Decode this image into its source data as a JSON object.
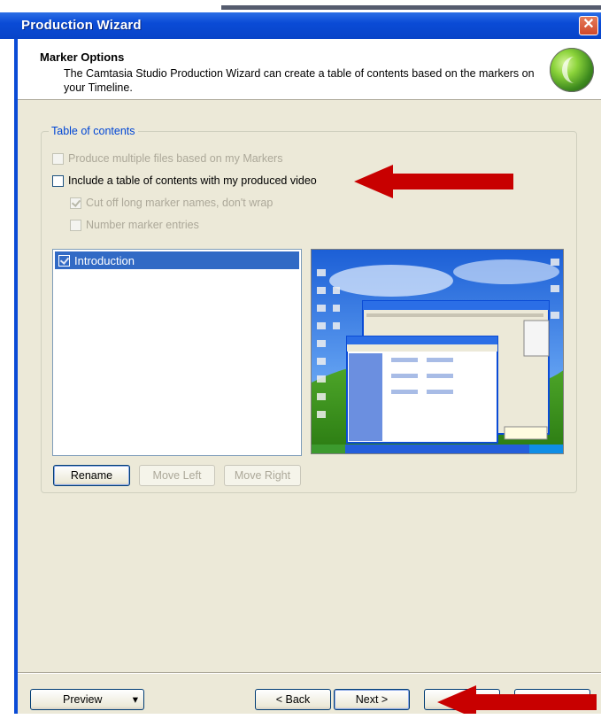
{
  "window": {
    "title": "Production Wizard",
    "close_symbol": "✕"
  },
  "header": {
    "title": "Marker Options",
    "description": "The Camtasia Studio Production Wizard can create a table of contents based on the markers on your Timeline."
  },
  "toc": {
    "legend": "Table of contents",
    "produce_multiple": {
      "label": "Produce multiple files based on my Markers",
      "checked": false,
      "enabled": false
    },
    "include_toc": {
      "label": "Include a table of contents with my produced video",
      "checked": false,
      "enabled": true
    },
    "cut_off": {
      "label": "Cut off long marker names, don't wrap",
      "checked": true,
      "enabled": false
    },
    "number_entries": {
      "label": "Number marker entries",
      "checked": false,
      "enabled": false
    },
    "markers": [
      {
        "label": "Introduction",
        "checked": true,
        "selected": true
      }
    ],
    "buttons": {
      "rename": "Rename",
      "move_left": "Move Left",
      "move_right": "Move Right"
    }
  },
  "footer": {
    "preview": "Preview",
    "preview_arrow": "▾",
    "back": "< Back",
    "next": "Next >",
    "finish": "",
    "cancel": ""
  },
  "colors": {
    "accent": "#0a4bd6",
    "annotation_arrow": "#c80000",
    "selection": "#316ac5"
  }
}
